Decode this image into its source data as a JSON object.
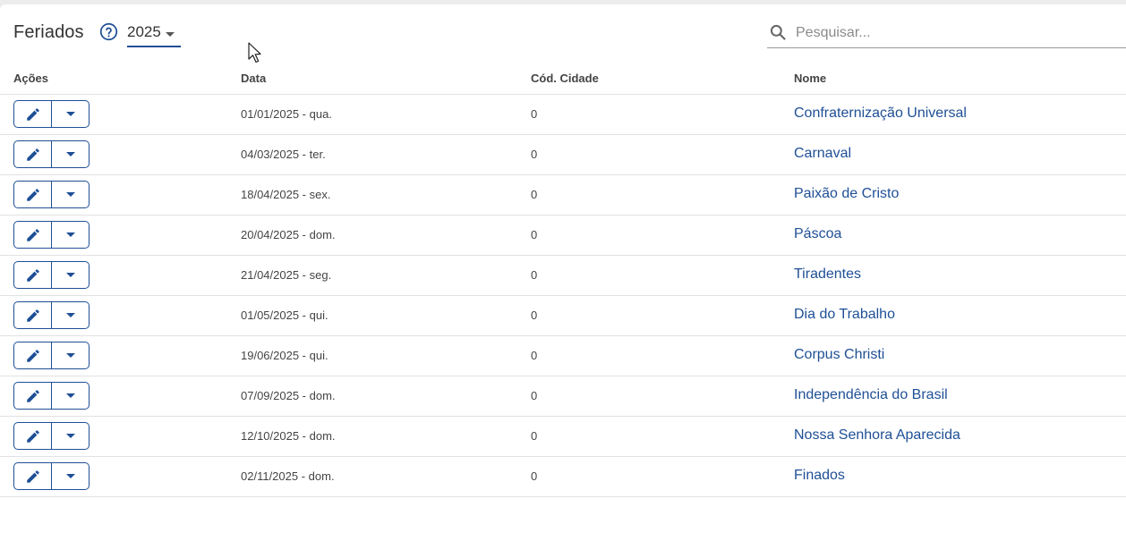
{
  "header": {
    "title": "Feriados",
    "year": "2025",
    "search_placeholder": "Pesquisar..."
  },
  "columns": {
    "acoes": "Ações",
    "data": "Data",
    "cod_cidade": "Cód. Cidade",
    "nome": "Nome"
  },
  "rows": [
    {
      "data": "01/01/2025 - qua.",
      "cod": "0",
      "nome": "Confraternização Universal"
    },
    {
      "data": "04/03/2025 - ter.",
      "cod": "0",
      "nome": "Carnaval"
    },
    {
      "data": "18/04/2025 - sex.",
      "cod": "0",
      "nome": "Paixão de Cristo"
    },
    {
      "data": "20/04/2025 - dom.",
      "cod": "0",
      "nome": "Páscoa"
    },
    {
      "data": "21/04/2025 - seg.",
      "cod": "0",
      "nome": "Tiradentes"
    },
    {
      "data": "01/05/2025 - qui.",
      "cod": "0",
      "nome": "Dia do Trabalho"
    },
    {
      "data": "19/06/2025 - qui.",
      "cod": "0",
      "nome": "Corpus Christi"
    },
    {
      "data": "07/09/2025 - dom.",
      "cod": "0",
      "nome": "Independência do Brasil"
    },
    {
      "data": "12/10/2025 - dom.",
      "cod": "0",
      "nome": "Nossa Senhora Aparecida"
    },
    {
      "data": "02/11/2025 - dom.",
      "cod": "0",
      "nome": "Finados"
    }
  ],
  "icons": {
    "help": "help-circle-icon",
    "search": "search-icon",
    "edit": "pencil-icon",
    "more": "caret-down-icon"
  },
  "colors": {
    "accent": "#1e4f96",
    "text": "#444444",
    "divider": "#e2e2e2"
  }
}
